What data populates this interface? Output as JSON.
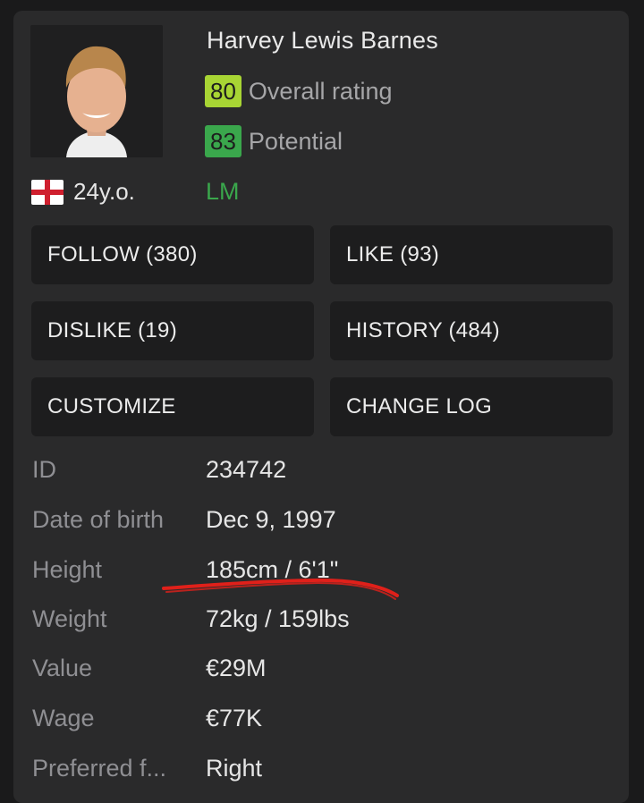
{
  "player": {
    "name": "Harvey Lewis Barnes",
    "overall_rating": "80",
    "overall_label": "Overall rating",
    "potential": "83",
    "potential_label": "Potential",
    "age": "24y.o.",
    "position": "LM",
    "nationality_icon": "england-flag-icon"
  },
  "colors": {
    "overall_badge": "#a8d534",
    "potential_badge": "#3aa74c",
    "position_text": "#3aa74c",
    "annotation_underline": "#e0201a"
  },
  "buttons": {
    "follow": "FOLLOW (380)",
    "like": "LIKE (93)",
    "dislike": "DISLIKE (19)",
    "history": "HISTORY (484)",
    "customize": "CUSTOMIZE",
    "change_log": "CHANGE LOG"
  },
  "info": {
    "id_label": "ID",
    "id_value": "234742",
    "dob_label": "Date of birth",
    "dob_value": "Dec 9, 1997",
    "height_label": "Height",
    "height_value": "185cm / 6'1\"",
    "weight_label": "Weight",
    "weight_value": "72kg / 159lbs",
    "value_label": "Value",
    "value_value": "€29M",
    "wage_label": "Wage",
    "wage_value": "€77K",
    "foot_label": "Preferred f...",
    "foot_value": "Right"
  }
}
